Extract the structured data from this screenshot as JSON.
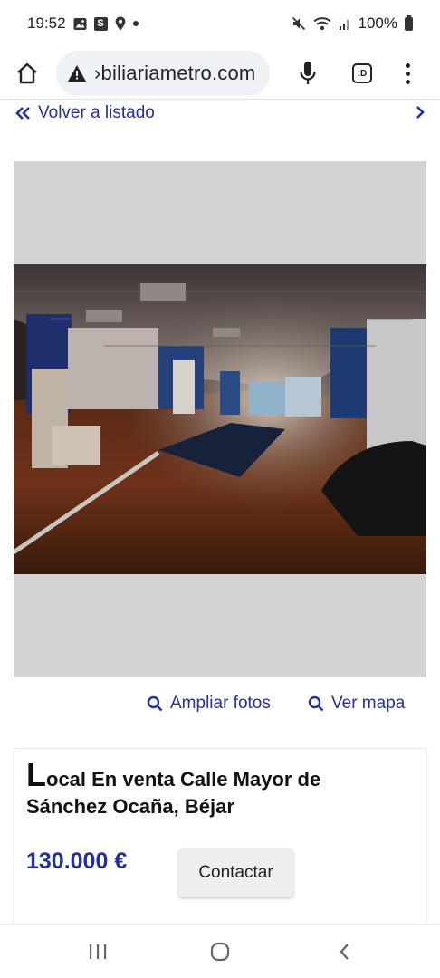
{
  "status_bar": {
    "time": "19:52",
    "battery": "100%",
    "icons_left": [
      "gallery-icon",
      "s-app-icon",
      "location-icon",
      "dot-icon"
    ],
    "icons_right": [
      "mute-icon",
      "wifi-icon",
      "signal-icon",
      "battery-icon"
    ]
  },
  "browser": {
    "url": "›biliariametro.com",
    "tabs_label": ":D",
    "icons": [
      "home-icon",
      "warning-icon",
      "mic-icon",
      "tabs-icon",
      "more-icon"
    ]
  },
  "listing_nav": {
    "back_label": "Volver a listado"
  },
  "photo_links": {
    "enlarge_label": "Ampliar fotos",
    "map_label": "Ver mapa"
  },
  "listing": {
    "title_initial": "L",
    "title_rest": "ocal En venta Calle Mayor de Sánchez Ocaña, Béjar",
    "price": "130.000 €",
    "contact_label": "Contactar"
  },
  "colors": {
    "accent": "#25309a",
    "photo_placeholder": "#d3d3d3"
  }
}
